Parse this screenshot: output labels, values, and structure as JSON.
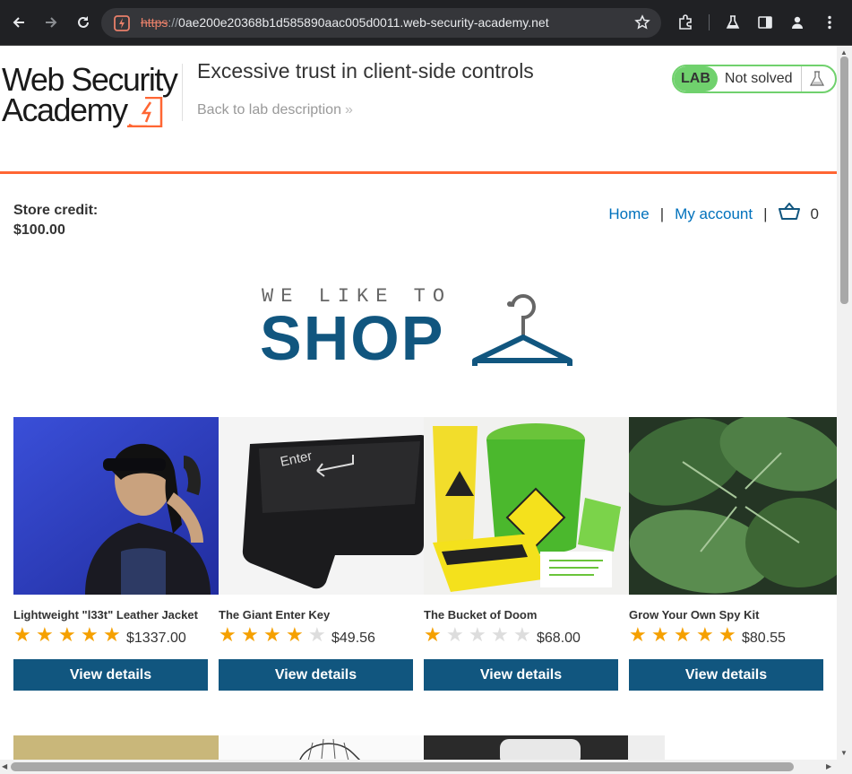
{
  "browser": {
    "url_scheme": "https",
    "url_separator": "://",
    "url_host": "0ae200e20368b1d585890aac005d0011.web-security-academy.net"
  },
  "header": {
    "logo_line1": "Web Security",
    "logo_line2": "Academy",
    "lab_title": "Excessive trust in client-side controls",
    "back_link": "Back to lab description",
    "lab_badge": "LAB",
    "lab_state": "Not solved"
  },
  "store": {
    "credit_label": "Store credit:",
    "credit_value": "$100.00",
    "nav": {
      "home": "Home",
      "pipe": "|",
      "my_account": "My account",
      "cart_count": "0"
    },
    "banner_top": "WE LIKE TO",
    "banner_main": "SHOP"
  },
  "products": [
    {
      "name": "Lightweight \"l33t\" Leather Jacket",
      "rating": 5,
      "price": "$1337.00",
      "button": "View details"
    },
    {
      "name": "The Giant Enter Key",
      "rating": 4,
      "price": "$49.56",
      "button": "View details"
    },
    {
      "name": "The Bucket of Doom",
      "rating": 1,
      "price": "$68.00",
      "button": "View details"
    },
    {
      "name": "Grow Your Own Spy Kit",
      "rating": 5,
      "price": "$80.55",
      "button": "View details"
    }
  ],
  "colors": {
    "accent_orange": "#ff6633",
    "brand_blue": "#11567f",
    "link_blue": "#0071bc",
    "lab_green": "#70d16d",
    "star_gold": "#f5a000"
  }
}
